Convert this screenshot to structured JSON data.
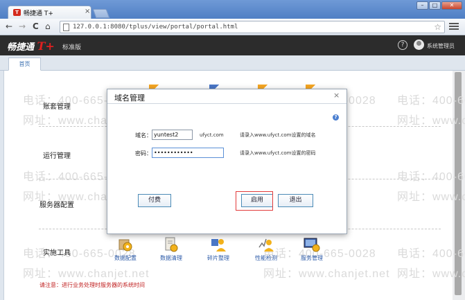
{
  "browser": {
    "tab_title": "畅捷通 T+",
    "tab_close": "×",
    "url": "127.0.0.1:8080/tplus/view/portal/portal.html",
    "nav": {
      "back": "←",
      "forward": "→",
      "reload": "C",
      "home": "⌂"
    },
    "star": "☆",
    "window_buttons": [
      "–",
      "□",
      "✕"
    ]
  },
  "header": {
    "logo_text": "畅捷通",
    "logo_mark": "T+",
    "edition": "标准版",
    "help": "?",
    "username": "系统管理员"
  },
  "tabs": [
    {
      "label": "首页"
    }
  ],
  "sections": [
    {
      "label": "账套管理"
    },
    {
      "label": "运行管理"
    },
    {
      "label": "服务器配置"
    },
    {
      "label": "实施工具"
    }
  ],
  "tools": [
    {
      "label": "数据配置",
      "icon": "gear-data-icon"
    },
    {
      "label": "数据清理",
      "icon": "document-gear-icon"
    },
    {
      "label": "碎片整理",
      "icon": "puzzle-user-icon"
    },
    {
      "label": "性能检测",
      "icon": "chart-user-icon"
    },
    {
      "label": "服务管理",
      "icon": "monitor-gear-icon"
    }
  ],
  "notice": "请注意：进行业务处理时服务器的系统时间",
  "watermark": {
    "phone": "电话：400-665-0028",
    "site": "网址：www.chanjet.net"
  },
  "dialog": {
    "title": "域名管理",
    "close": "×",
    "help": "?",
    "domain_label": "域名：",
    "domain_value": "yuntest2",
    "domain_suffix": "ufyct.com",
    "domain_hint": "请录入www.ufyct.com设置的域名",
    "password_label": "密码：",
    "password_value": "••••••••••••",
    "password_hint": "请录入www.ufyct.com设置的密码",
    "buttons": {
      "pay": "付费",
      "enable": "启用",
      "exit": "退出"
    }
  },
  "colors": {
    "header_bg": "#2c2c2c",
    "logo_red": "#e02020",
    "link_blue": "#2b5aa8",
    "highlight_red": "#e23a3a"
  }
}
